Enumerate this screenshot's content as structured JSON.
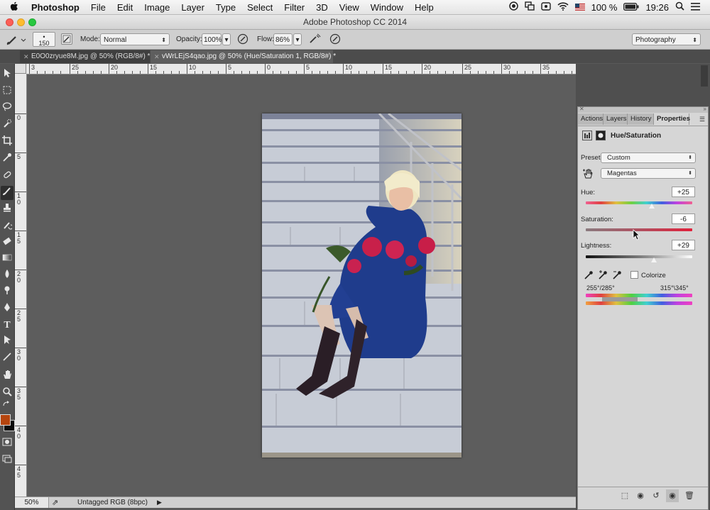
{
  "menubar": {
    "apple": "",
    "items": [
      "Photoshop",
      "File",
      "Edit",
      "Image",
      "Layer",
      "Type",
      "Select",
      "Filter",
      "3D",
      "View",
      "Window",
      "Help"
    ],
    "battery": "100 %",
    "time": "19:26"
  },
  "window": {
    "title": "Adobe Photoshop CC 2014"
  },
  "options": {
    "brush_size": "150",
    "mode_label": "Mode:",
    "mode_value": "Normal",
    "opacity_label": "Opacity:",
    "opacity_value": "100%",
    "flow_label": "Flow:",
    "flow_value": "86%",
    "workspace": "Photography"
  },
  "tabs": [
    {
      "label": "E0O0zryue8M.jpg @ 50% (RGB/8#) *"
    },
    {
      "label": "vWrLEjS4qao.jpg @ 50% (Hue/Saturation 1, RGB/8#) *"
    }
  ],
  "ruler": {
    "h": [
      "3",
      "25",
      "20",
      "15",
      "10",
      "5",
      "0",
      "5",
      "10",
      "15",
      "20",
      "25",
      "30",
      "35",
      "40",
      "45",
      "50"
    ],
    "v": [
      "0",
      "5",
      "1\n0",
      "1\n5",
      "2\n0",
      "2\n5",
      "3\n0",
      "3\n5",
      "4\n0",
      "4\n5"
    ]
  },
  "status": {
    "zoom": "50%",
    "profile": "Untagged RGB (8bpc)"
  },
  "panel": {
    "tabs": [
      "Actions",
      "Layers",
      "History",
      "Properties"
    ],
    "title": "Hue/Saturation",
    "preset_label": "Preset:",
    "preset_value": "Custom",
    "channel_value": "Magentas",
    "hue_label": "Hue:",
    "hue_value": "+25",
    "saturation_label": "Saturation:",
    "saturation_value": "-6",
    "lightness_label": "Lightness:",
    "lightness_value": "+29",
    "colorize_label": "Colorize",
    "range_left": "255°/285°",
    "range_right": "315°\\345°"
  },
  "colors": {
    "foreground": "#b5450f",
    "background": "#0a0a0a"
  }
}
